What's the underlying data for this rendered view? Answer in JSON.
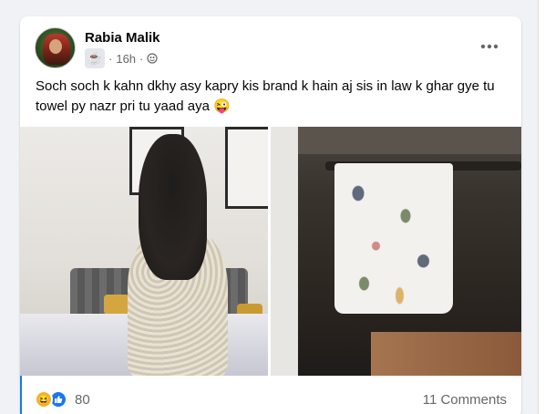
{
  "post": {
    "author_name": "Rabia Malik",
    "time": "16h",
    "privacy_icon": "globe-icon",
    "group_icon": "coffee-icon",
    "more_icon": "more-options-icon",
    "text": "Soch soch k kahn dkhy asy kapry kis brand k hain aj sis in law k ghar gye tu towel py nazr pri tu yaad aya 😜"
  },
  "reactions": {
    "count": "80",
    "icons": [
      "haha-icon",
      "like-icon"
    ],
    "comments_label": "11 Comments"
  },
  "colors": {
    "accent": "#1877f2",
    "secondary_text": "#65676b",
    "primary_text": "#050505"
  }
}
